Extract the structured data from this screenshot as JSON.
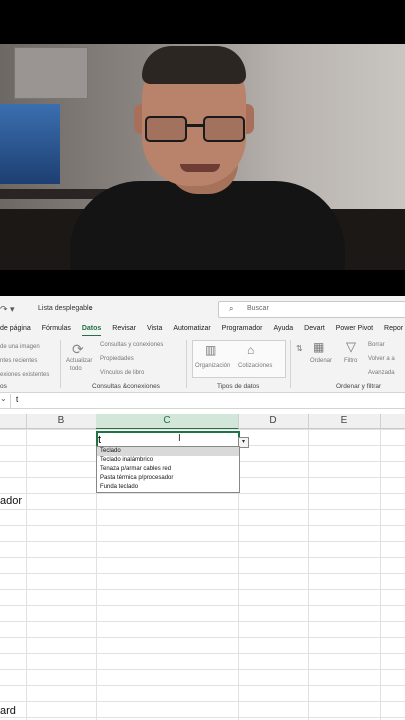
{
  "excel": {
    "toolbar": {
      "list_label": "Lista desplegable",
      "search_placeholder": "Buscar"
    },
    "tabs": [
      {
        "label": "de página",
        "active": false
      },
      {
        "label": "Fórmulas",
        "active": false
      },
      {
        "label": "Datos",
        "active": true
      },
      {
        "label": "Revisar",
        "active": false
      },
      {
        "label": "Vista",
        "active": false
      },
      {
        "label": "Automatizar",
        "active": false
      },
      {
        "label": "Programador",
        "active": false
      },
      {
        "label": "Ayuda",
        "active": false
      },
      {
        "label": "Devart",
        "active": false
      },
      {
        "label": "Power Pivot",
        "active": false
      },
      {
        "label": "Repor",
        "active": false
      }
    ],
    "ribbon": {
      "left_items": [
        "de una imagen",
        "ntes recientes",
        "exiones existentes"
      ],
      "left_group": "os",
      "refresh_label": "Actualizar",
      "refresh_sub": "todo",
      "query_items": [
        "Consultas y conexiones",
        "Propiedades",
        "Vínculos de libro"
      ],
      "query_group": "Consultas &conexiones",
      "datatype_items": [
        "Organización",
        "Cotizaciones"
      ],
      "datatype_group": "Tipos de datos",
      "sort_label": "Ordenar",
      "filter_label": "Filtro",
      "filter_items": [
        "Borrar",
        "Volver a a",
        "Avanzada"
      ],
      "sort_group": "Ordenar y filtrar"
    },
    "formula_value": "t",
    "columns": [
      "B",
      "C",
      "D",
      "E"
    ],
    "active_cell_value": "t",
    "dropdown_options": [
      "Teclado",
      "Teclado inalámbrico",
      "Tenaza p/armar cables red",
      "Pasta térmica p/procesador",
      "Funda teclado"
    ],
    "cell_fragments": [
      "ador",
      "ard"
    ]
  }
}
